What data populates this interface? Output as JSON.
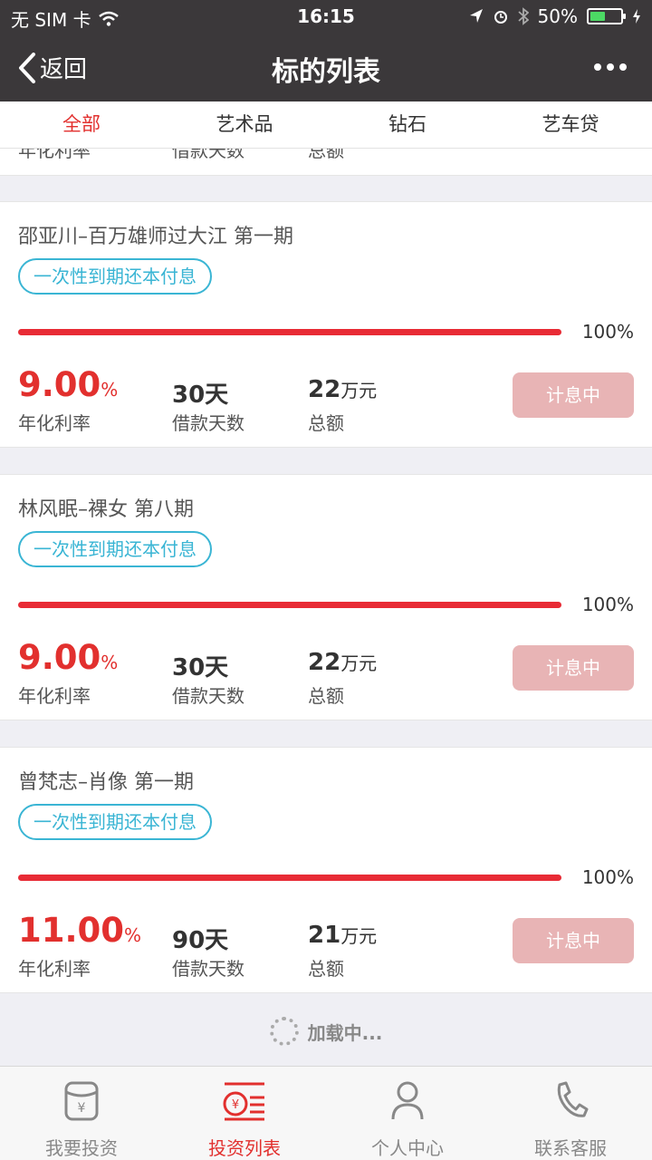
{
  "status": {
    "carrier": "无 SIM 卡",
    "time": "16:15",
    "battery": "50%",
    "battery_level": 0.5
  },
  "nav": {
    "back_label": "返回",
    "title": "标的列表"
  },
  "tabs": [
    {
      "label": "全部",
      "active": true
    },
    {
      "label": "艺术品",
      "active": false
    },
    {
      "label": "钻石",
      "active": false
    },
    {
      "label": "艺车贷",
      "active": false
    }
  ],
  "partial_card": {
    "label1": "年化利率",
    "label2": "借款天数",
    "label3": "总额"
  },
  "cards": [
    {
      "name": "邵亚川–百万雄师过大江 第一期",
      "repay": "一次性到期还本付息",
      "progress_label": "100%",
      "progress": 1.0,
      "rate": "9.00",
      "rate_unit": "%",
      "rate_label": "年化利率",
      "days": "30天",
      "days_label": "借款天数",
      "amount": "22",
      "amount_unit": "万元",
      "amount_label": "总额",
      "status": "计息中"
    },
    {
      "name": "林风眠–裸女 第八期",
      "repay": "一次性到期还本付息",
      "progress_label": "100%",
      "progress": 1.0,
      "rate": "9.00",
      "rate_unit": "%",
      "rate_label": "年化利率",
      "days": "30天",
      "days_label": "借款天数",
      "amount": "22",
      "amount_unit": "万元",
      "amount_label": "总额",
      "status": "计息中"
    },
    {
      "name": "曾梵志–肖像 第一期",
      "repay": "一次性到期还本付息",
      "progress_label": "100%",
      "progress": 1.0,
      "rate": "11.00",
      "rate_unit": "%",
      "rate_label": "年化利率",
      "days": "90天",
      "days_label": "借款天数",
      "amount": "21",
      "amount_unit": "万元",
      "amount_label": "总额",
      "status": "计息中"
    }
  ],
  "loading_text": "加载中...",
  "tabbar": [
    {
      "label": "我要投资",
      "icon": "wallet-icon",
      "active": false
    },
    {
      "label": "投资列表",
      "icon": "invest-list-icon",
      "active": true
    },
    {
      "label": "个人中心",
      "icon": "person-icon",
      "active": false
    },
    {
      "label": "联系客服",
      "icon": "phone-icon",
      "active": false
    }
  ],
  "colors": {
    "accent": "#e2302e",
    "progress": "#e82b35",
    "badge": "#3ab5d4",
    "button_disabled": "#e8b4b5",
    "header_bg": "#3b383a"
  }
}
